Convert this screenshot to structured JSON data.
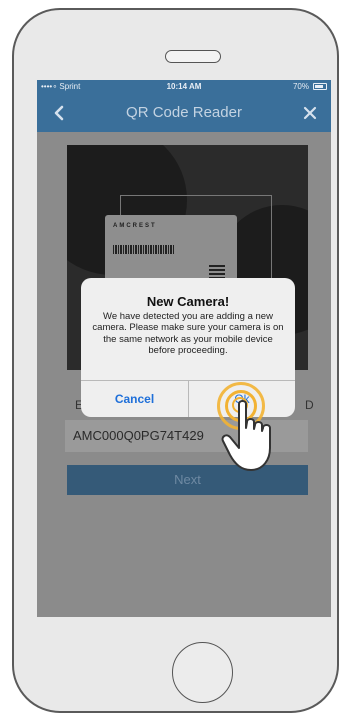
{
  "status_bar": {
    "carrier": "••••∘ Sprint",
    "time": "10:14 AM",
    "battery": "70%"
  },
  "nav": {
    "title": "QR Code Reader",
    "back_icon": "chevron-left-icon",
    "close_icon": "close-icon"
  },
  "camera": {
    "label_brand": "AMCREST"
  },
  "serial": {
    "value": "AMC000Q0PG74T429"
  },
  "next_button": {
    "label": "Next"
  },
  "alert": {
    "title": "New Camera!",
    "message": "We have detected you are adding a new camera. Please make sure your camera is on the same network as your mobile device before proceeding.",
    "cancel_label": "Cancel",
    "ok_label": "Ok"
  },
  "colors": {
    "nav_blue": "#3a6f9a",
    "link_blue": "#1e6fd9",
    "tap_highlight": "#f2b233"
  }
}
